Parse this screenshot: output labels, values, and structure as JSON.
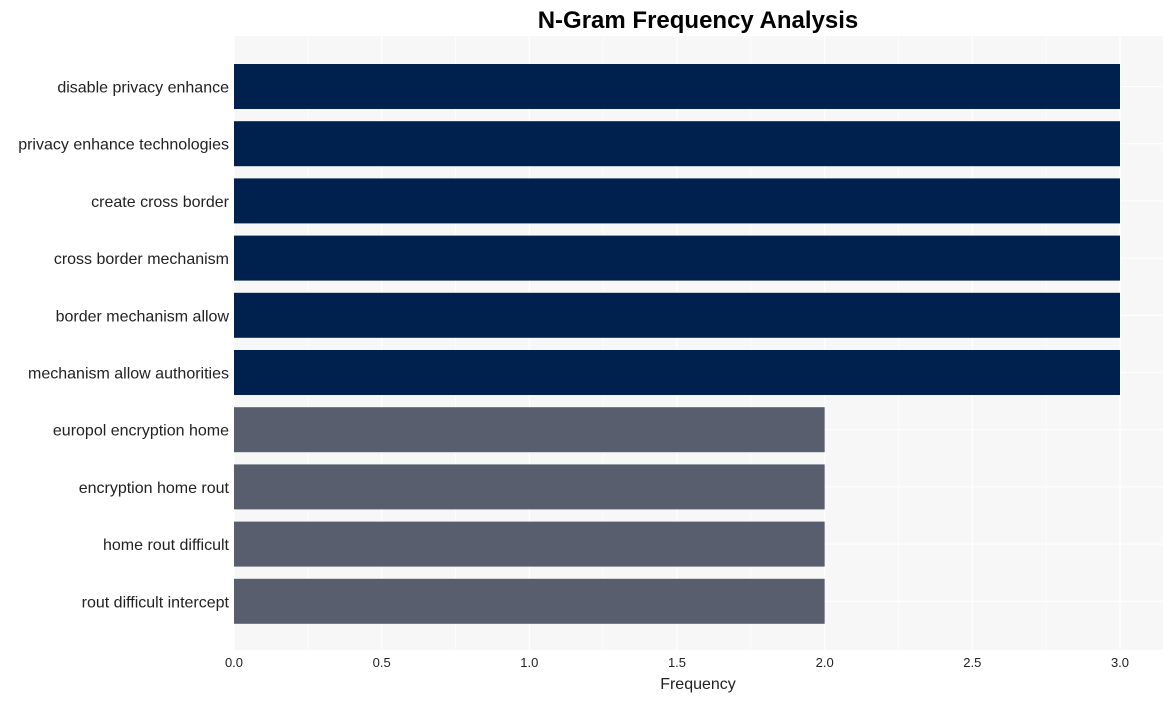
{
  "chart_data": {
    "type": "bar",
    "orientation": "horizontal",
    "title": "N-Gram Frequency Analysis",
    "xlabel": "Frequency",
    "ylabel": "",
    "categories": [
      "disable privacy enhance",
      "privacy enhance technologies",
      "create cross border",
      "cross border mechanism",
      "border mechanism allow",
      "mechanism allow authorities",
      "europol encryption home",
      "encryption home rout",
      "home rout difficult",
      "rout difficult intercept"
    ],
    "values": [
      3,
      3,
      3,
      3,
      3,
      3,
      2,
      2,
      2,
      2
    ],
    "xlim": [
      0,
      3.15
    ],
    "xticks": [
      0.0,
      0.5,
      1.0,
      1.5,
      2.0,
      2.5,
      3.0
    ],
    "xtick_labels": [
      "0.0",
      "0.5",
      "1.0",
      "1.5",
      "2.0",
      "2.5",
      "3.0"
    ],
    "grid": true,
    "legend": "none",
    "colors": {
      "high": "#00214d",
      "low": "#595e6e",
      "plot_background": "#f7f7f7",
      "grid": "#ffffff"
    }
  }
}
